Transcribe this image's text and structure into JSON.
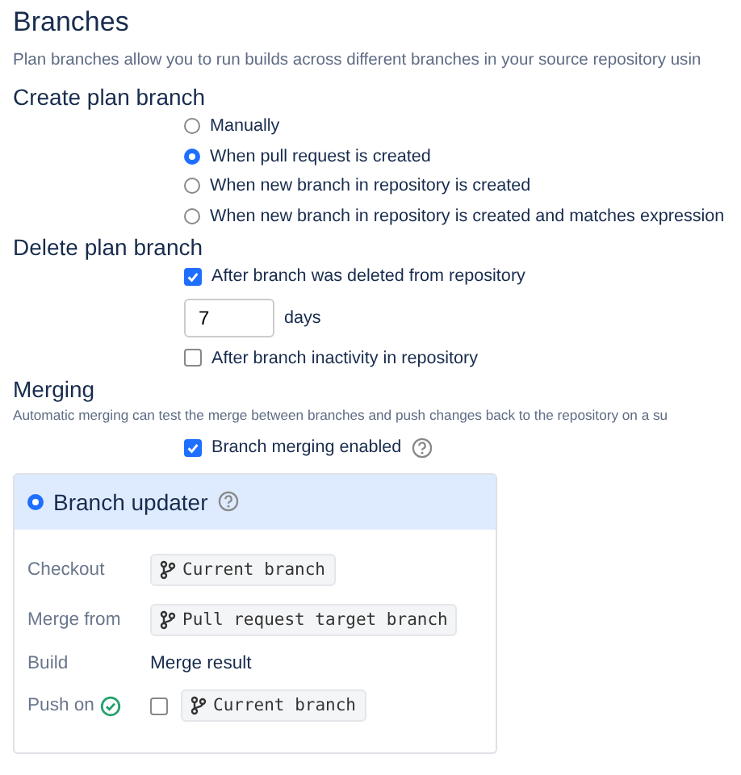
{
  "title": "Branches",
  "description": "Plan branches allow you to run builds across different branches in your source repository usin",
  "create_plan_branch": {
    "heading": "Create plan branch",
    "options": [
      {
        "label": "Manually",
        "selected": false
      },
      {
        "label": "When pull request is created",
        "selected": true
      },
      {
        "label": "When new branch in repository is created",
        "selected": false
      },
      {
        "label": "When new branch in repository is created and matches expression",
        "selected": false
      }
    ]
  },
  "delete_plan_branch": {
    "heading": "Delete plan branch",
    "after_deleted": {
      "label": "After branch was deleted from repository",
      "checked": true
    },
    "days": {
      "value": "7",
      "unit": "days"
    },
    "after_inactivity": {
      "label": "After branch inactivity in repository",
      "checked": false
    }
  },
  "merging": {
    "heading": "Merging",
    "description": "Automatic merging can test the merge between branches and push changes back to the repository on a su",
    "enabled": {
      "label": "Branch merging enabled",
      "checked": true
    },
    "panel": {
      "title": "Branch updater",
      "selected": true,
      "checkout_label": "Checkout",
      "checkout": "Current branch",
      "merge_from_label": "Merge from",
      "merge_from": "Pull request target branch",
      "build_label": "Build",
      "build": "Merge result",
      "push_label": "Push on",
      "push": {
        "checked": false,
        "branch": "Current branch"
      }
    }
  }
}
